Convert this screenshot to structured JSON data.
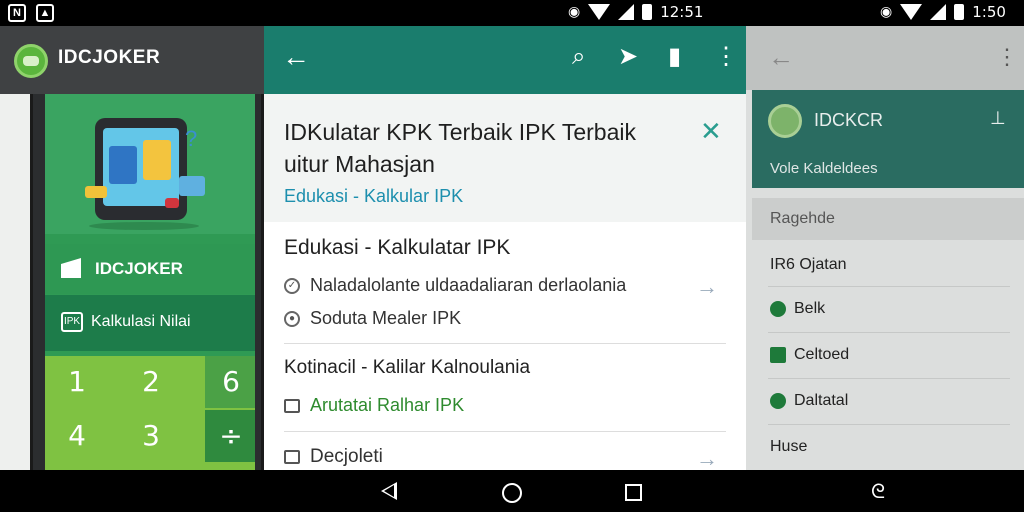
{
  "status_bar": {
    "time_center": "12:51",
    "time_right": "1:50"
  },
  "left_app": {
    "title": "IDCJOKER",
    "brand": "IDCJOKER",
    "calc_label": "Kalkulasi Nilai",
    "calc_icon": "IPK",
    "keys": [
      "1",
      "2",
      "6",
      "4",
      "3",
      "÷"
    ]
  },
  "center_dialog": {
    "title": "IDKulatar KPK Terbaik IPK Terbaik uitur Mahasjan",
    "subtitle": "Edukasi - Kalkular IPK",
    "section1": {
      "heading": "Edukasi - Kalkulatar IPK",
      "line1": "Naladalolante uldaadaliaran derlaolania",
      "line2": "Soduta Mealer IPK"
    },
    "section2": {
      "heading": "Kotinacil - Kalilar Kalnoulania",
      "line1": "Arutatai Ralhar IPK"
    },
    "section3": {
      "heading": "Decjoleti"
    }
  },
  "right_panel": {
    "card_name": "IDCKCR",
    "card_pin": "⊥",
    "card_subtitle": "Vole Kaldeldees",
    "section_label": "Ragehde",
    "items": [
      "IR6 Ojatan",
      "Belk",
      "Celtoed",
      "Daltatal",
      "Huse"
    ]
  },
  "colors": {
    "teal_appbar": "#1a7d6d",
    "green_accent": "#2f9a54",
    "link_blue": "#1d8fae",
    "link_green": "#2e8b2e"
  }
}
